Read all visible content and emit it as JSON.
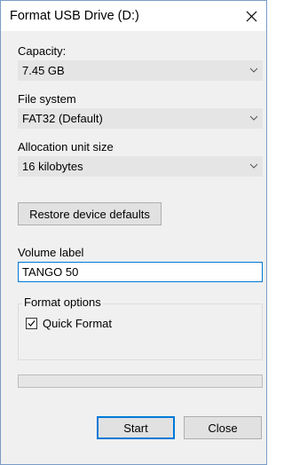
{
  "window": {
    "title": "Format USB Drive (D:)"
  },
  "capacity": {
    "label": "Capacity:",
    "value": "7.45 GB"
  },
  "file_system": {
    "label": "File system",
    "value": "FAT32 (Default)"
  },
  "allocation": {
    "label": "Allocation unit size",
    "value": "16 kilobytes"
  },
  "restore_button": "Restore device defaults",
  "volume": {
    "label": "Volume label",
    "value": "TANGO 50"
  },
  "format_options": {
    "title": "Format options",
    "quick_format_label": "Quick Format",
    "quick_format_checked": true
  },
  "progress": {
    "fraction": 0
  },
  "buttons": {
    "start": "Start",
    "close": "Close"
  },
  "colors": {
    "accent": "#0078d7",
    "window_bg": "#f0f0f0"
  }
}
